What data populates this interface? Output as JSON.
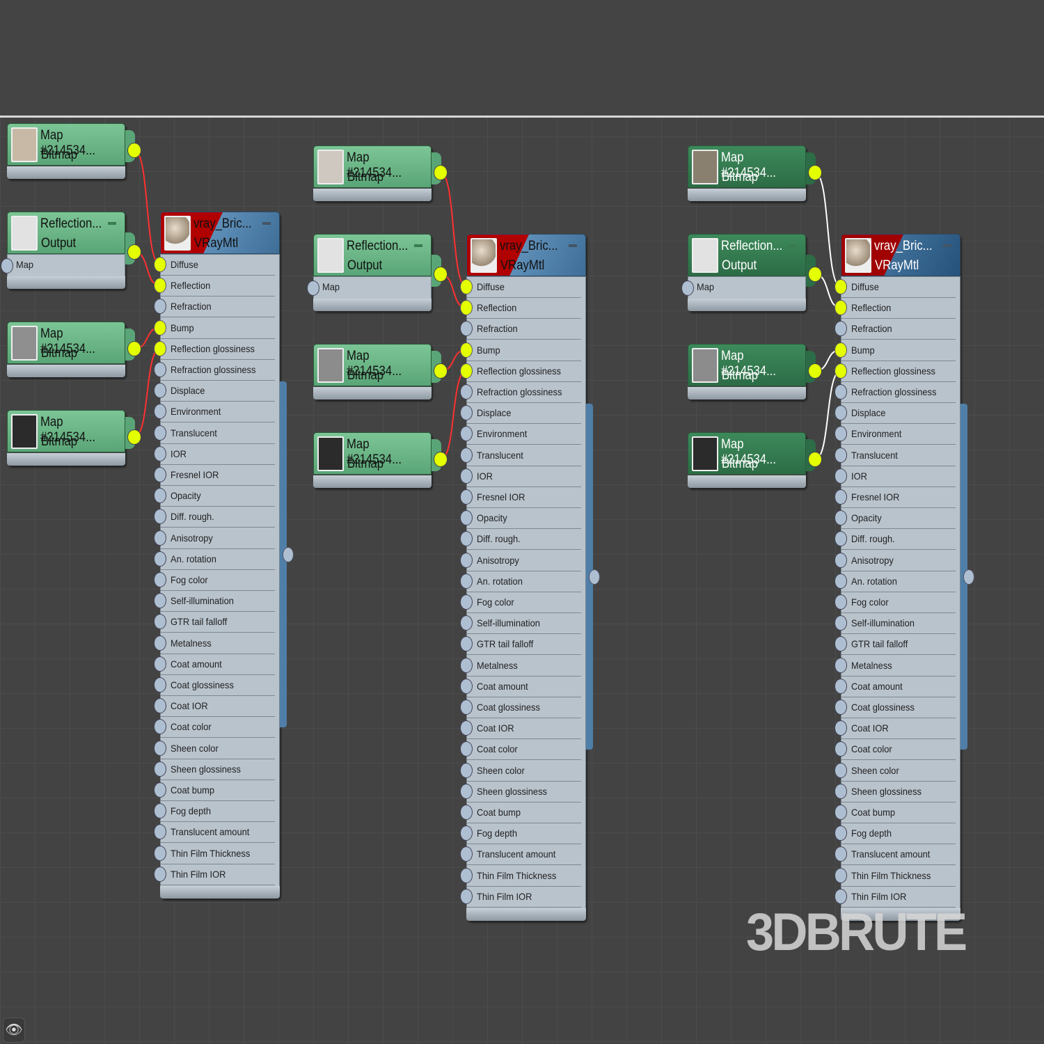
{
  "groups": [
    {
      "style": "light",
      "wire_color": "#ff3030",
      "maps": [
        {
          "title": "Map #214534...",
          "type": "Bitmap",
          "thumb": "#c8b9a6"
        },
        {
          "title": "Reflection...",
          "type": "Output",
          "thumb": "#e2e2e2",
          "input": "Map"
        },
        {
          "title": "Map #214534...",
          "type": "Bitmap",
          "thumb": "#8f8f8f"
        },
        {
          "title": "Map #214534...",
          "type": "Bitmap",
          "thumb": "#2b2b2b"
        }
      ],
      "material": {
        "title": "vray_Bric...",
        "type": "VRayMtl"
      }
    },
    {
      "style": "light",
      "wire_color": "#ff3030",
      "maps": [
        {
          "title": "Map #214534...",
          "type": "Bitmap",
          "thumb": "#cfc8c0"
        },
        {
          "title": "Reflection...",
          "type": "Output",
          "thumb": "#e2e2e2",
          "input": "Map"
        },
        {
          "title": "Map #214534...",
          "type": "Bitmap",
          "thumb": "#8c8c8c"
        },
        {
          "title": "Map #214534...",
          "type": "Bitmap",
          "thumb": "#2b2b2b"
        }
      ],
      "material": {
        "title": "vray_Bric...",
        "type": "VRayMtl"
      }
    },
    {
      "style": "dark",
      "wire_color": "#ffffff",
      "maps": [
        {
          "title": "Map #214534...",
          "type": "Bitmap",
          "thumb": "#8a8070"
        },
        {
          "title": "Reflection...",
          "type": "Output",
          "thumb": "#e2e2e2",
          "input": "Map"
        },
        {
          "title": "Map #214534...",
          "type": "Bitmap",
          "thumb": "#8c8c8c"
        },
        {
          "title": "Map #214534...",
          "type": "Bitmap",
          "thumb": "#2b2b2b"
        }
      ],
      "material": {
        "title": "vray_Bric...",
        "type": "VRayMtl"
      }
    }
  ],
  "slots": [
    "Diffuse",
    "Reflection",
    "Refraction",
    "Bump",
    "Reflection glossiness",
    "Refraction glossiness",
    "Displace",
    "Environment",
    "Translucent",
    "IOR",
    "Fresnel IOR",
    "Opacity",
    "Diff. rough.",
    "Anisotropy",
    "An. rotation",
    "Fog color",
    "Self-illumination",
    "GTR tail falloff",
    "Metalness",
    "Coat amount",
    "Coat glossiness",
    "Coat IOR",
    "Coat color",
    "Sheen color",
    "Sheen glossiness",
    "Coat bump",
    "Fog depth",
    "Translucent amount",
    "Thin Film Thickness",
    "Thin Film IOR"
  ],
  "connected_slots": [
    "Diffuse",
    "Reflection",
    "Bump",
    "Reflection glossiness"
  ],
  "connections": [
    {
      "from_map": 0,
      "to_slot": "Diffuse"
    },
    {
      "from_map": 1,
      "to_slot": "Reflection"
    },
    {
      "from_map": 2,
      "to_slot": "Bump"
    },
    {
      "from_map": 3,
      "to_slot": "Reflection glossiness"
    }
  ],
  "watermark": "3DBRUTE",
  "colors": {
    "socket_connected": "#e3ff00",
    "background": "#434343",
    "map_header": "#6fb98a",
    "material_header": "#4f7fa8"
  },
  "icons": {
    "navigator": "binoculars-icon"
  }
}
